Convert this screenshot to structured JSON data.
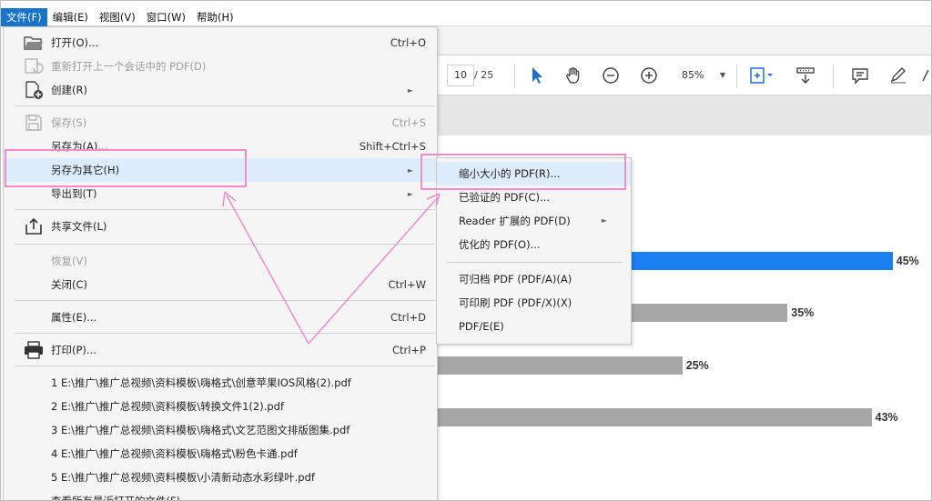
{
  "menubar": {
    "items": [
      {
        "label": "文件(F)",
        "active": true
      },
      {
        "label": "编辑(E)"
      },
      {
        "label": "视图(V)"
      },
      {
        "label": "窗口(W)"
      },
      {
        "label": "帮助(H)"
      }
    ]
  },
  "toolbar": {
    "page_current": "10",
    "page_total": "/ 25",
    "zoom": "85%"
  },
  "file_menu": {
    "items": [
      {
        "label": "打开(O)...",
        "shortcut": "Ctrl+O",
        "icon": "open-folder-icon"
      },
      {
        "label": "重新打开上一个会话中的 PDF(D)",
        "disabled": true,
        "icon": "reopen-icon"
      },
      {
        "label": "创建(R)",
        "submenu": true,
        "icon": "create-pdf-icon"
      },
      {
        "label": "保存(S)",
        "shortcut": "Ctrl+S",
        "disabled": true,
        "icon": "save-icon"
      },
      {
        "label": "另存为(A)...",
        "shortcut": "Shift+Ctrl+S"
      },
      {
        "label": "另存为其它(H)",
        "submenu": true
      },
      {
        "label": "导出到(T)",
        "submenu": true
      },
      {
        "label": "共享文件(L)",
        "icon": "share-icon"
      },
      {
        "label": "恢复(V)",
        "disabled": true
      },
      {
        "label": "关闭(C)",
        "shortcut": "Ctrl+W"
      },
      {
        "label": "属性(E)...",
        "shortcut": "Ctrl+D"
      },
      {
        "label": "打印(P)...",
        "shortcut": "Ctrl+P",
        "icon": "print-icon"
      }
    ],
    "recent_files": [
      "1 E:\\推广\\推广总视频\\资料模板\\嗨格式\\创意苹果IOS风格(2).pdf",
      "2 E:\\推广\\推广总视频\\资料模板\\转换文件1(2).pdf",
      "3 E:\\推广\\推广总视频\\资料模板\\嗨格式\\文艺范图文排版图集.pdf",
      "4 E:\\推广\\推广总视频\\资料模板\\嗨格式\\粉色卡通.pdf",
      "5 E:\\推广\\推广总视频\\资料模板\\小清新动态水彩绿叶.pdf"
    ],
    "last_partial": "查看所有最近打开的文件(F)..."
  },
  "save_as_other_submenu": {
    "items": [
      {
        "label": "缩小大小的 PDF(R)..."
      },
      {
        "label": "已验证的 PDF(C)..."
      },
      {
        "label": "Reader 扩展的 PDF(D)",
        "submenu": true
      },
      {
        "label": "优化的 PDF(O)..."
      },
      {
        "label": "可归档 PDF (PDF/A)(A)"
      },
      {
        "label": "可印刷 PDF (PDF/X)(X)"
      },
      {
        "label": "PDF/E(E)"
      }
    ]
  },
  "chart_data": {
    "type": "bar",
    "orientation": "horizontal",
    "values": [
      45,
      35,
      25,
      43
    ],
    "labels": [
      "45%",
      "35%",
      "25%",
      "43%"
    ],
    "colors": [
      "#1a7ff0",
      "#a6a6a6",
      "#a6a6a6",
      "#a6a6a6"
    ]
  },
  "colors": {
    "accent": "#1873c9",
    "highlight": "#f08cc8",
    "menu_hover": "#dcecfb"
  }
}
